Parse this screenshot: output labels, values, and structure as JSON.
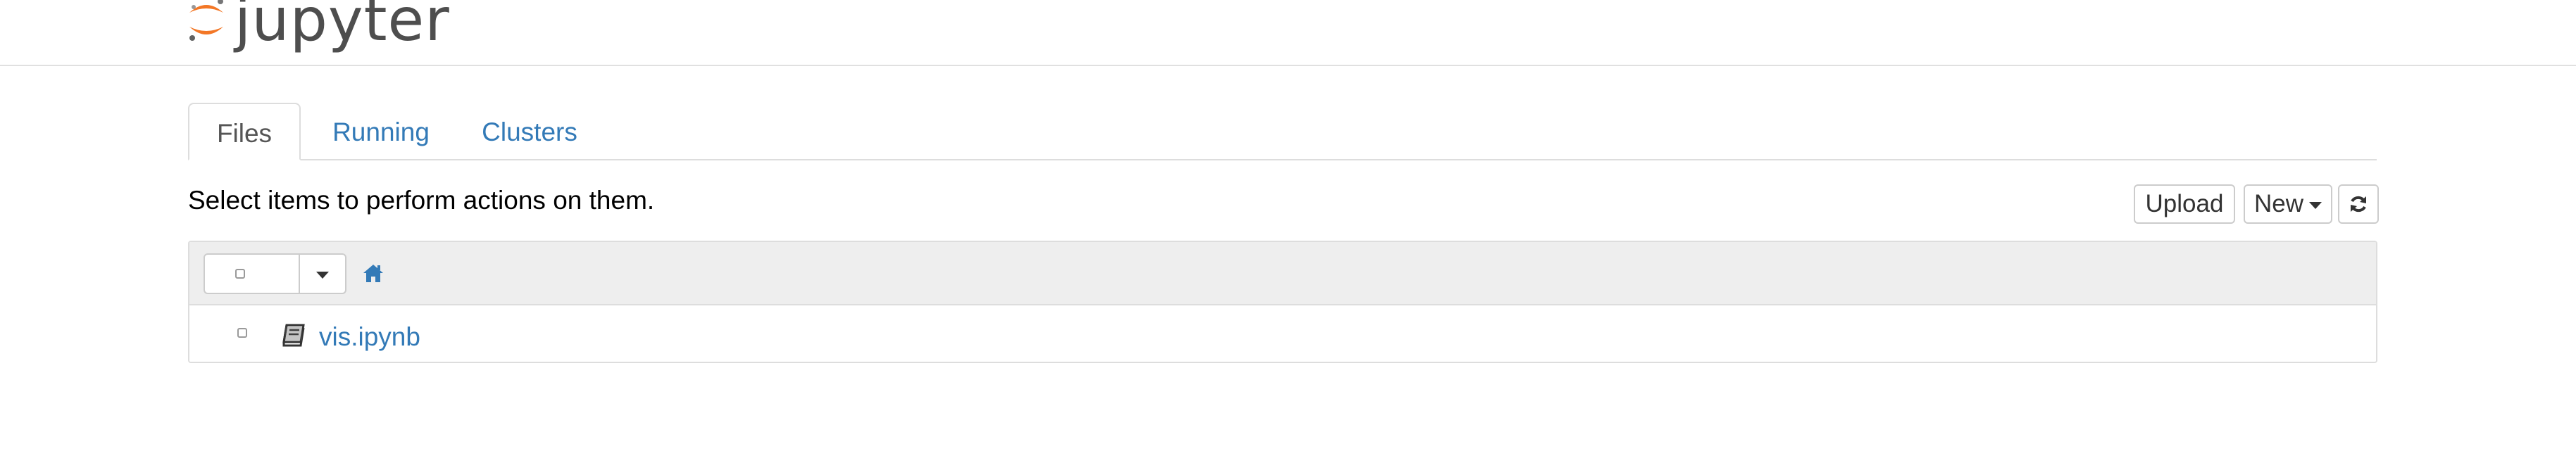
{
  "header": {
    "logo_text": "jupyter"
  },
  "tabs": [
    {
      "label": "Files",
      "active": true
    },
    {
      "label": "Running",
      "active": false
    },
    {
      "label": "Clusters",
      "active": false
    }
  ],
  "toolbar": {
    "hint": "Select items to perform actions on them.",
    "upload_label": "Upload",
    "new_label": "New",
    "refresh_icon": "refresh-icon"
  },
  "file_list": {
    "breadcrumb_icon": "home-icon",
    "items": [
      {
        "name": "vis.ipynb",
        "icon": "notebook-icon"
      }
    ]
  },
  "colors": {
    "link": "#337ab7",
    "logo_orange": "#f37726",
    "header_bg": "#eeeeee"
  }
}
